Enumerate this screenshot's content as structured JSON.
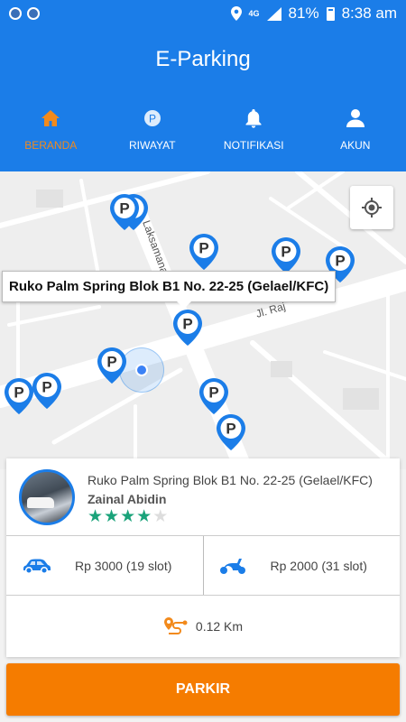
{
  "status_bar": {
    "network": "4G",
    "battery": "81%",
    "time": "8:38 am"
  },
  "header": {
    "title": "E-Parking"
  },
  "tabs": [
    {
      "label": "BERANDA",
      "icon": "home-icon",
      "active": true
    },
    {
      "label": "RIWAYAT",
      "icon": "parking-history-icon",
      "active": false
    },
    {
      "label": "NOTIFIKASI",
      "icon": "bell-icon",
      "active": false
    },
    {
      "label": "AKUN",
      "icon": "person-icon",
      "active": false
    }
  ],
  "map": {
    "info_window_title": "Ruko Palm Spring Blok B1 No. 22-25 (Gelael/KFC)",
    "pin_label": "P",
    "street_labels": {
      "street_1": "Laksamana B",
      "street_2": "Jl. Raj"
    }
  },
  "card": {
    "place_name": "Ruko Palm Spring Blok B1 No. 22-25 (Gelael/KFC)",
    "owner_name": "Zainal Abidin",
    "rating": 4,
    "rating_max": 5,
    "car_price": "Rp 3000 (19 slot)",
    "motor_price": "Rp 2000 (31 slot)",
    "distance": "0.12 Km"
  },
  "colors": {
    "primary": "#1b7de8",
    "accent_orange": "#f57c00",
    "star_green": "#1aa37a"
  },
  "parkir_button": {
    "label": "PARKIR"
  }
}
